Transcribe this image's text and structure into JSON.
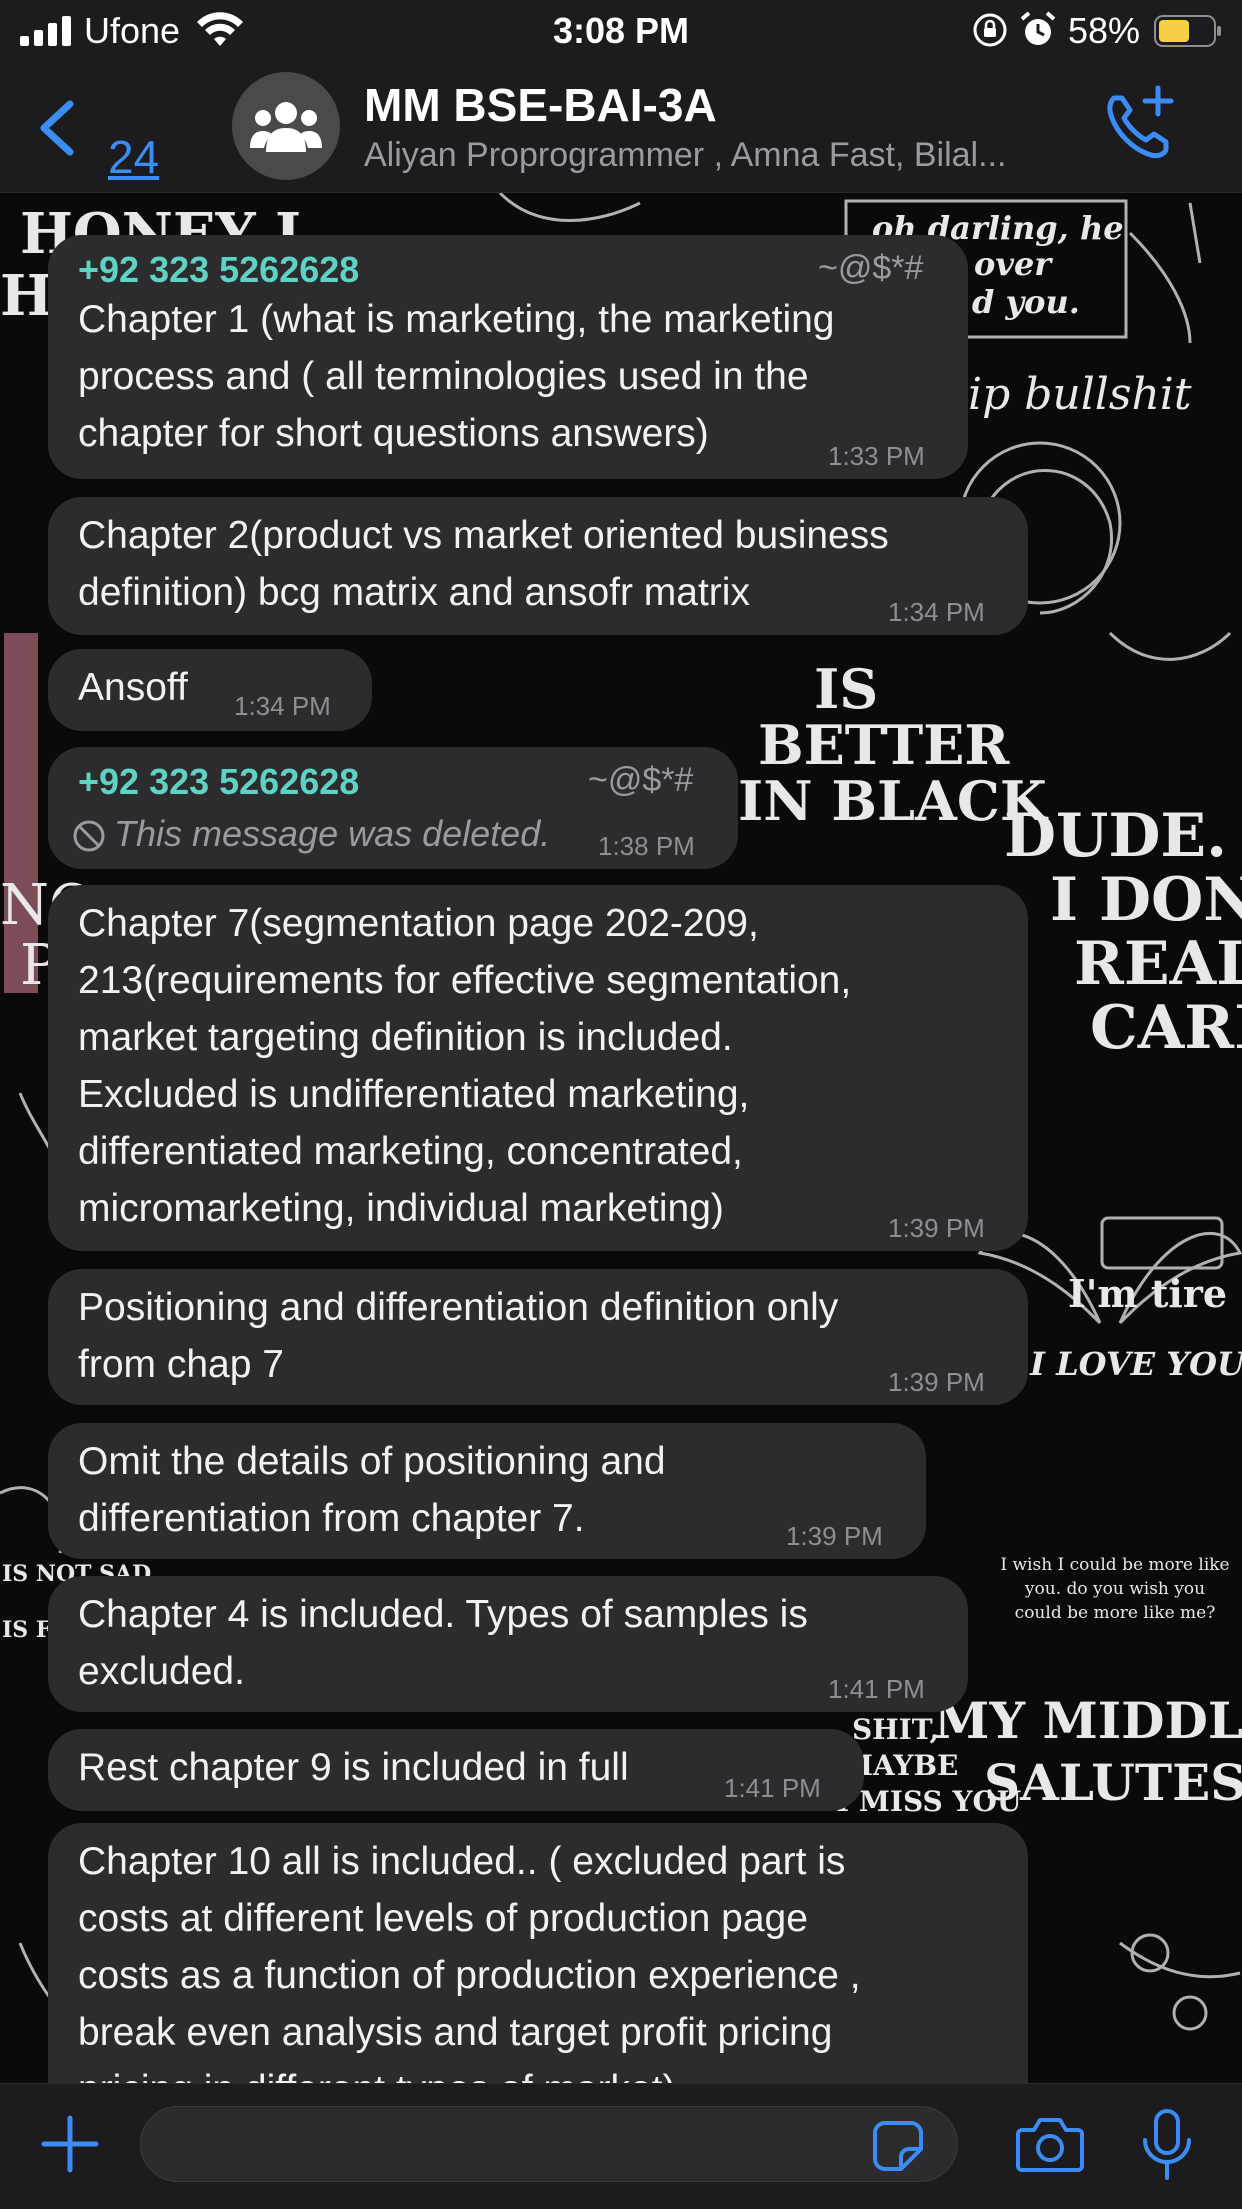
{
  "status_bar": {
    "carrier": "Ufone",
    "time": "3:08 PM",
    "battery": "58%"
  },
  "header": {
    "back_count": "24",
    "title": "MM BSE-BAI-3A",
    "members": "Aliyan Proprogrammer , Amna Fast, Bilal..."
  },
  "messages": [
    {
      "sender": "+92 323 5262628",
      "sender_tag": "~@$*#",
      "lines": [
        "Chapter 1 (what is marketing, the marketing",
        "process and ( all terminologies used in the",
        "chapter for short questions answers)"
      ],
      "time": "1:33 PM"
    },
    {
      "lines": [
        "Chapter 2(product vs market oriented business",
        "definition) bcg matrix and ansofr matrix"
      ],
      "time": "1:34 PM"
    },
    {
      "lines": [
        "Ansoff"
      ],
      "time": "1:34 PM"
    },
    {
      "sender": "+92 323 5262628",
      "sender_tag": "~@$*#",
      "deleted_text": "This message was deleted.",
      "time": "1:38 PM"
    },
    {
      "lines": [
        "Chapter 7(segmentation page 202-209,",
        "213(requirements for effective segmentation,",
        "market targeting definition is included.",
        "Excluded is undifferentiated marketing,",
        "differentiated marketing, concentrated,",
        "micromarketing, individual marketing)"
      ],
      "time": "1:39 PM"
    },
    {
      "lines": [
        "Positioning and differentiation definition only",
        "from chap 7"
      ],
      "time": "1:39 PM"
    },
    {
      "lines": [
        "Omit the details of positioning and",
        "differentiation from chapter 7."
      ],
      "time": "1:39 PM"
    },
    {
      "lines": [
        "Chapter 4 is included. Types of samples is",
        "excluded."
      ],
      "time": "1:41 PM"
    },
    {
      "lines": [
        "Rest chapter 9 is included in full"
      ],
      "time": "1:41 PM"
    },
    {
      "lines": [
        "Chapter 10 all is included.. ( excluded part is",
        "costs at different levels of production page",
        "costs as a function of production experience ,",
        "break even analysis and target profit pricing",
        "pricing in different types of market)"
      ]
    }
  ],
  "wallpaper_text": [
    "HONEY I",
    "HA",
    "oh darling, he",
    "over",
    "d you.",
    "ip bullshit",
    "IS",
    "BETTER",
    "IN BLACK",
    "DUDE.",
    "I DON'T",
    "REALLY",
    "CARE",
    "I'm tire",
    "I LOVE YOU",
    "MY MIDDLE FINGE",
    "SALUTES YOU.",
    "I wish I could be more like you. do you wish you could be more like me?",
    "IS NOT SAD",
    "IS F",
    "SHIT,",
    "MAYBE",
    "I MISS YOU",
    "NO",
    "P"
  ],
  "icons": {
    "back": "chevron-left-icon",
    "group": "group-icon",
    "call": "add-call-icon",
    "plus": "plus-icon",
    "sticker": "sticker-icon",
    "camera": "camera-icon",
    "mic": "mic-icon",
    "deleted": "blocked-icon"
  },
  "colors": {
    "accent": "#3b8cf5",
    "sender": "#5fd3c3",
    "bubble": "#2c2c2e",
    "bar": "#1c1c1e"
  }
}
